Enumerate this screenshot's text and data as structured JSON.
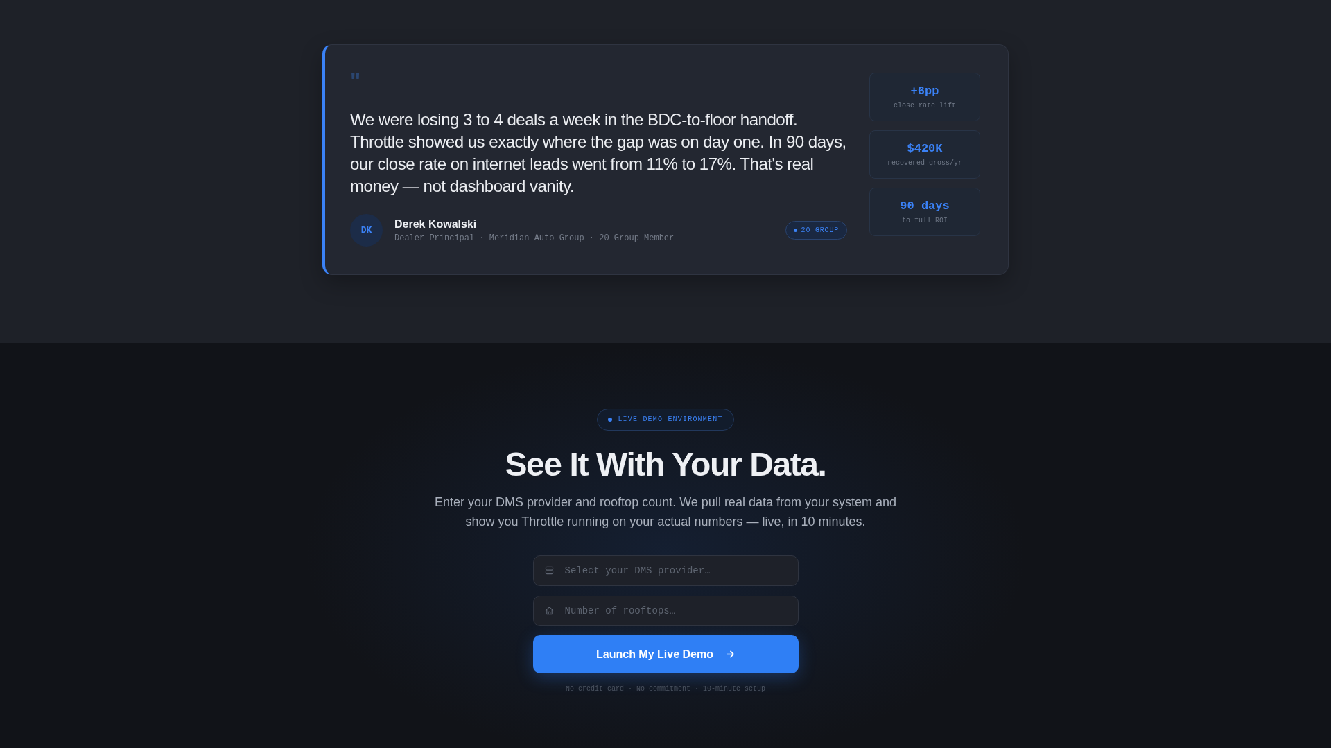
{
  "testimonial": {
    "quote_mark": "\"",
    "quote": "We were losing 3 to 4 deals a week in the BDC-to-floor handoff. Throttle showed us exactly where the gap was on day one. In 90 days, our close rate on internet leads went from 11% to 17%. That's real money — not dashboard vanity.",
    "author": {
      "initials": "DK",
      "name": "Derek Kowalski",
      "role": "Dealer Principal · Meridian Auto Group · 20 Group Member"
    },
    "tag": "20 GROUP",
    "stats": [
      {
        "value": "+6pp",
        "label": "close rate lift"
      },
      {
        "value": "$420K",
        "label": "recovered gross/yr"
      },
      {
        "value": "90 days",
        "label": "to full ROI"
      }
    ]
  },
  "demo": {
    "tag": "LIVE DEMO ENVIRONMENT",
    "heading": "See It With Your Data.",
    "description": "Enter your DMS provider and rooftop count. We pull real data from your system and show you Throttle running on your actual numbers — live, in 10 minutes.",
    "fields": [
      {
        "kind": "select",
        "placeholder": "Select your DMS provider…"
      },
      {
        "kind": "number",
        "placeholder": "Number of rooftops…"
      }
    ],
    "button": "Launch My Live Demo",
    "footnote": "No credit card · No commitment · 10-minute setup"
  }
}
